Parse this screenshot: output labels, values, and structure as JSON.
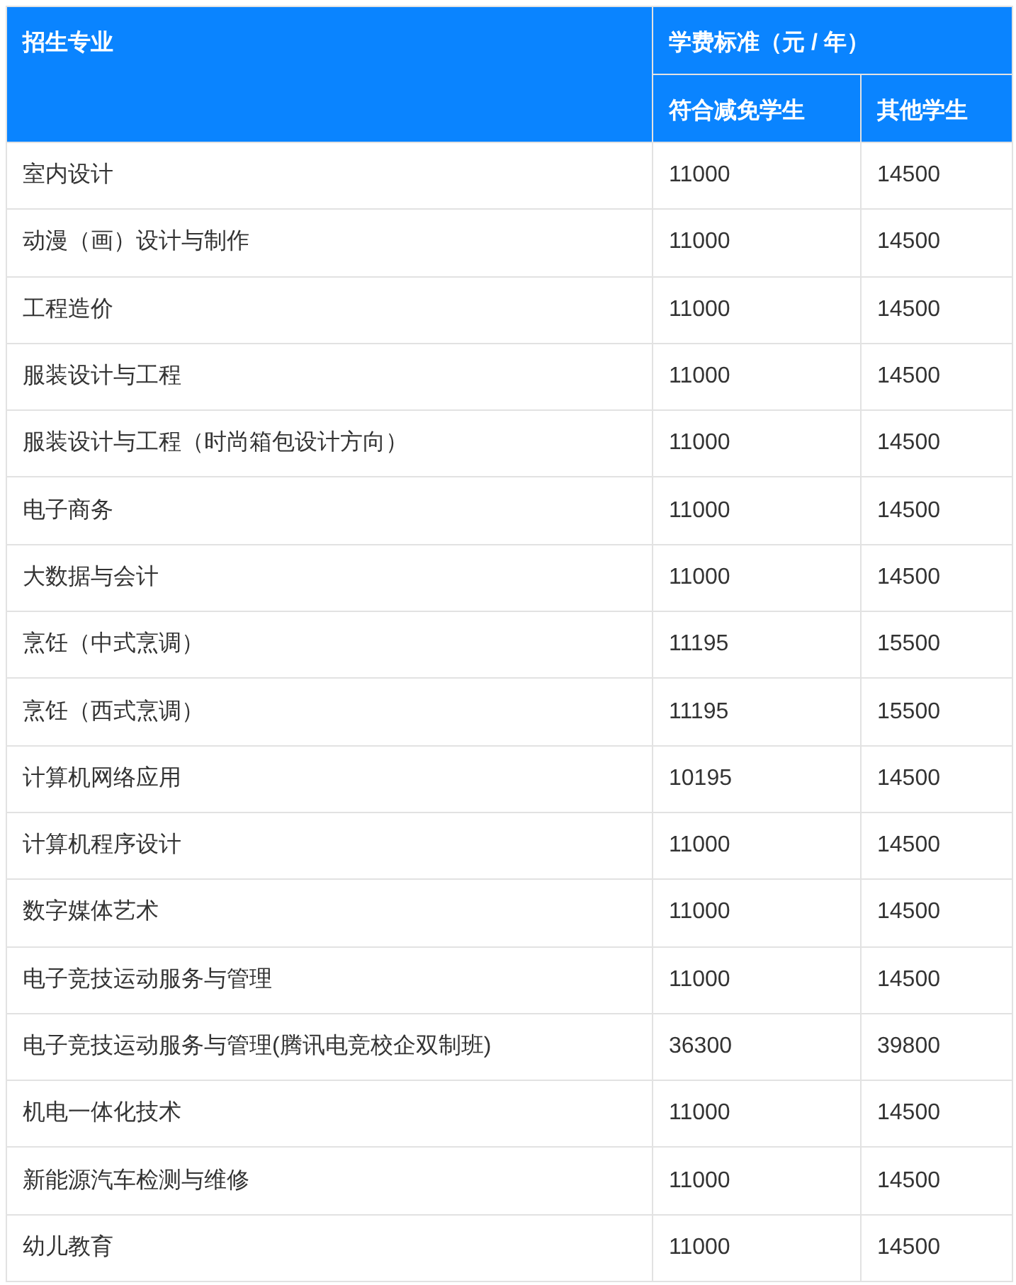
{
  "table": {
    "header": {
      "major": "招生专业",
      "fee_group": "学费标准（元 / 年）",
      "columns": [
        "符合减免学生",
        "其他学生"
      ]
    },
    "rows": [
      {
        "major": "室内设计",
        "reduced": "11000",
        "other": "14500"
      },
      {
        "major": "动漫（画）设计与制作",
        "reduced": "11000",
        "other": "14500"
      },
      {
        "major": "工程造价",
        "reduced": "11000",
        "other": "14500"
      },
      {
        "major": "服装设计与工程",
        "reduced": "11000",
        "other": "14500"
      },
      {
        "major": "服装设计与工程（时尚箱包设计方向）",
        "reduced": "11000",
        "other": "14500"
      },
      {
        "major": "电子商务",
        "reduced": "11000",
        "other": "14500"
      },
      {
        "major": "大数据与会计",
        "reduced": "11000",
        "other": "14500"
      },
      {
        "major": "烹饪（中式烹调）",
        "reduced": "11195",
        "other": "15500"
      },
      {
        "major": "烹饪（西式烹调）",
        "reduced": "11195",
        "other": "15500"
      },
      {
        "major": "计算机网络应用",
        "reduced": "10195",
        "other": "14500"
      },
      {
        "major": "计算机程序设计",
        "reduced": "11000",
        "other": "14500"
      },
      {
        "major": "数字媒体艺术",
        "reduced": "11000",
        "other": "14500"
      },
      {
        "major": "电子竞技运动服务与管理",
        "reduced": "11000",
        "other": "14500"
      },
      {
        "major": "电子竞技运动服务与管理(腾讯电竞校企双制班)",
        "reduced": "36300",
        "other": "39800"
      },
      {
        "major": "机电一体化技术",
        "reduced": "11000",
        "other": "14500"
      },
      {
        "major": "新能源汽车检测与维修",
        "reduced": "11000",
        "other": "14500"
      },
      {
        "major": "幼儿教育",
        "reduced": "11000",
        "other": "14500"
      }
    ]
  }
}
